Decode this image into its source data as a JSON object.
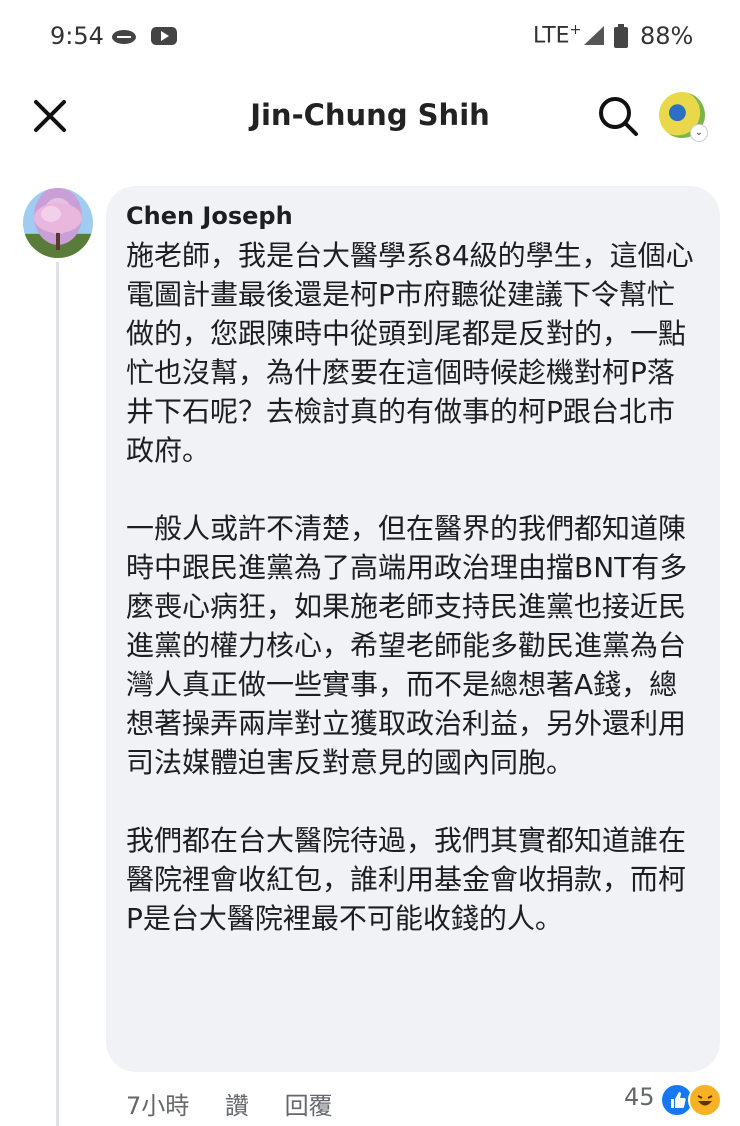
{
  "status_bar": {
    "time": "9:54",
    "network": "LTE",
    "network_sup": "+",
    "battery_percent": "88%"
  },
  "header": {
    "title": "Jin-Chung Shih"
  },
  "comment": {
    "author": "Chen Joseph",
    "paragraphs": [
      "施老師，我是台大醫學系84級的學生，這個心電圖計畫最後還是柯P市府聽從建議下令幫忙做的，您跟陳時中從頭到尾都是反對的，一點忙也沒幫，為什麼要在這個時候趁機對柯P落井下石呢？去檢討真的有做事的柯P跟台北市政府。",
      "一般人或許不清楚，但在醫界的我們都知道陳時中跟民進黨為了高端用政治理由擋BNT有多麼喪心病狂，如果施老師支持民進黨也接近民進黨的權力核心，希望老師能多勸民進黨為台灣人真正做一些實事，而不是總想著A錢，總想著操弄兩岸對立獲取政治利益，另外還利用司法媒體迫害反對意見的國內同胞。",
      "我們都在台大醫院待過，我們其實都知道誰在醫院裡會收紅包，誰利用基金會收捐款，而柯P是台大醫院裡最不可能收錢的人。"
    ],
    "timestamp": "7小時",
    "like_label": "讚",
    "reply_label": "回覆",
    "reaction_count": "45",
    "reactions": [
      "like-icon",
      "haha-icon"
    ]
  },
  "colors": {
    "bubble_bg": "#f0f2f5",
    "meta_text": "#65676b",
    "like_blue": "#1877f2",
    "haha_yellow": "#f7b125"
  }
}
